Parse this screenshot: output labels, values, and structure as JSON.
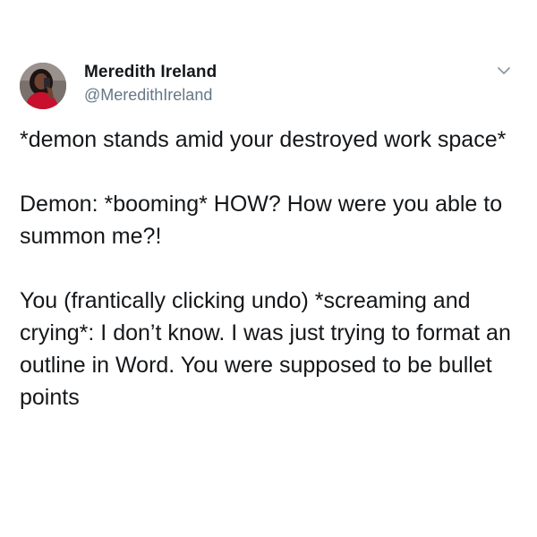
{
  "author": {
    "display_name": "Meredith Ireland",
    "handle": "@MeredithIreland",
    "avatar_icon": "profile-photo"
  },
  "menu": {
    "icon": "chevron-down-icon"
  },
  "tweet": {
    "paragraphs": [
      "*demon stands amid your destroyed work space*",
      "Demon: *booming* HOW? How were you able to summon me?!",
      "You (frantically clicking undo) *screaming and crying*: I don’t know. I was just trying to format an outline in Word. You were supposed to be bullet points"
    ]
  },
  "colors": {
    "text": "#14171a",
    "muted": "#657786",
    "background": "#ffffff",
    "avatar_accent": "#c8102e"
  }
}
